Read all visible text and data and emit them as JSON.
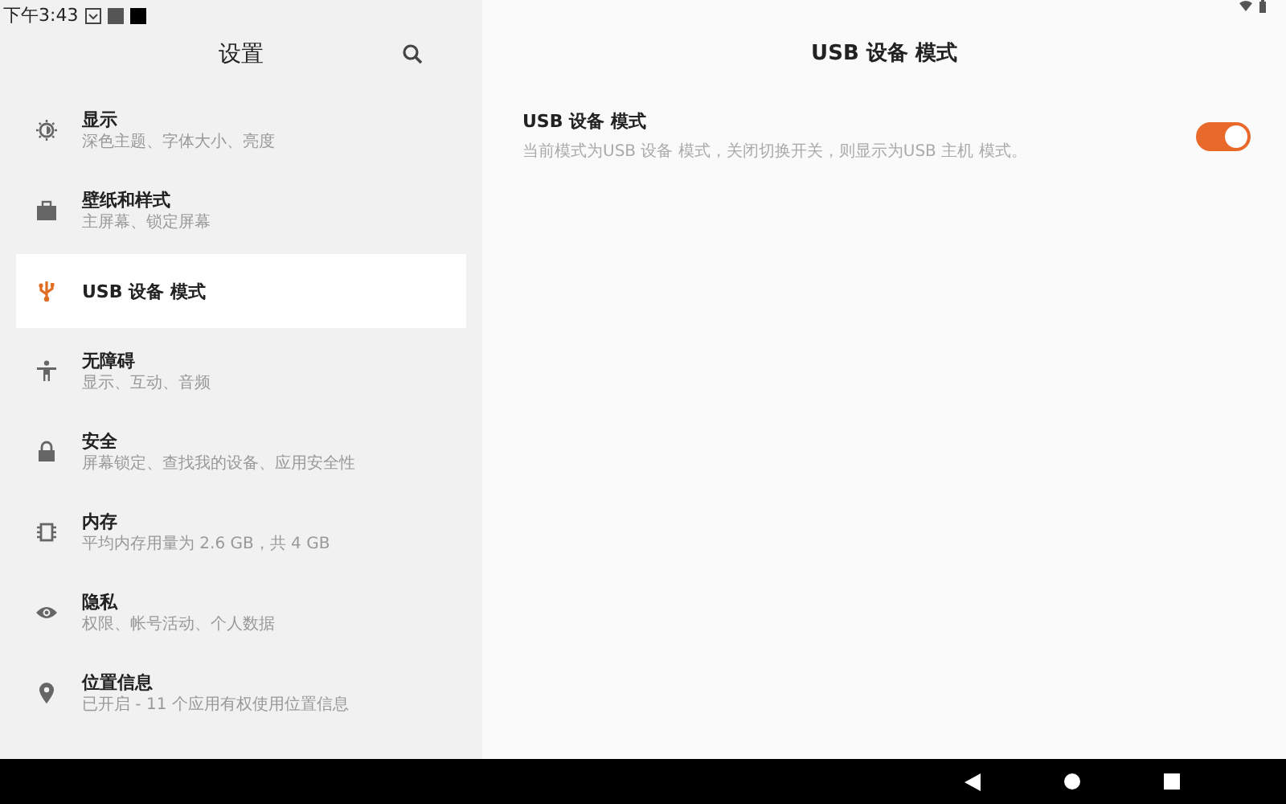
{
  "status_bar": {
    "time": "下午3:43"
  },
  "sidebar": {
    "title": "设置",
    "items": [
      {
        "title": "显示",
        "subtitle": "深色主题、字体大小、亮度",
        "selected": false
      },
      {
        "title": "壁纸和样式",
        "subtitle": "主屏幕、锁定屏幕",
        "selected": false
      },
      {
        "title": "USB 设备 模式",
        "selected": true
      },
      {
        "title": "无障碍",
        "subtitle": "显示、互动、音频",
        "selected": false
      },
      {
        "title": "安全",
        "subtitle": "屏幕锁定、查找我的设备、应用安全性",
        "selected": false
      },
      {
        "title": "内存",
        "subtitle": "平均内存用量为 2.6 GB，共 4 GB",
        "selected": false
      },
      {
        "title": "隐私",
        "subtitle": "权限、帐号活动、个人数据",
        "selected": false
      },
      {
        "title": "位置信息",
        "subtitle": "已开启 - 11 个应用有权使用位置信息",
        "selected": false
      }
    ]
  },
  "detail": {
    "title": "USB 设备 模式",
    "setting": {
      "title": "USB 设备 模式",
      "subtitle": "当前模式为USB 设备 模式，关闭切换开关，则显示为USB 主机 模式。",
      "on": true
    }
  }
}
